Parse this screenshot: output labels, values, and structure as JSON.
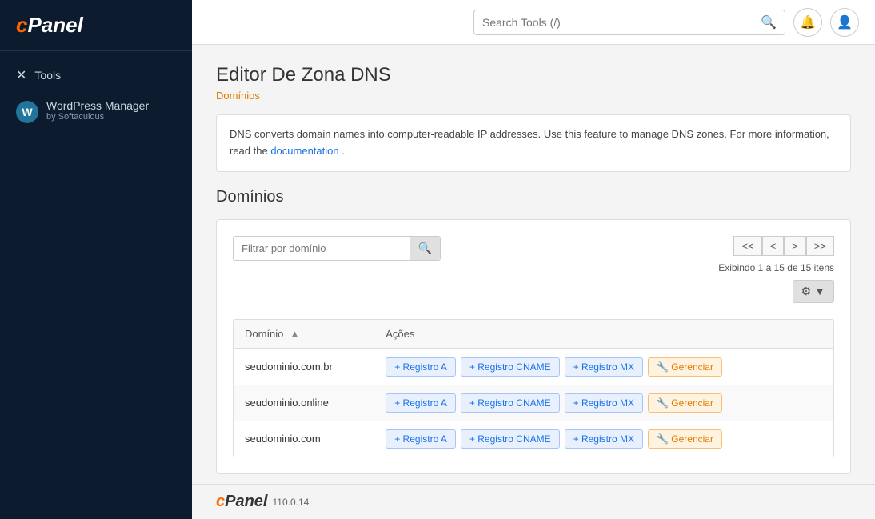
{
  "sidebar": {
    "logo": "cPanel",
    "items": [
      {
        "id": "tools",
        "label": "Tools",
        "icon": "✕"
      }
    ],
    "wordpress": {
      "title": "WordPress Manager",
      "subtitle": "by Softaculous"
    }
  },
  "header": {
    "search_placeholder": "Search Tools (/)",
    "search_value": ""
  },
  "page": {
    "title": "Editor De Zona DNS",
    "breadcrumb": "Domínios",
    "description_plain": "DNS converts domain names into computer-readable IP addresses.",
    "description_link_text": "Use this feature to manage DNS zones. For more information, read the",
    "doc_link": "documentation",
    "description_end": ".",
    "domains_section_title": "Domínios",
    "filter_placeholder": "Filtrar por domínio",
    "pagination": {
      "first": "<<",
      "prev": "<",
      "next": ">",
      "last": ">>",
      "info": "Exibindo 1 a 15 de 15 itens"
    },
    "table": {
      "col_domain": "Domínio",
      "col_actions": "Ações",
      "rows": [
        {
          "domain": "seudominio.com.br",
          "actions": [
            "+ Registro A",
            "+ Registro CNAME",
            "+ Registro MX",
            "🔧 Gerenciar"
          ]
        },
        {
          "domain": "seudominio.online",
          "actions": [
            "+ Registro A",
            "+ Registro CNAME",
            "+ Registro MX",
            "🔧 Gerenciar"
          ]
        },
        {
          "domain": "seudominio.com",
          "actions": [
            "+ Registro A",
            "+ Registro CNAME",
            "+ Registro MX",
            "🔧 Gerenciar"
          ]
        }
      ]
    }
  },
  "footer": {
    "logo_c": "c",
    "logo_panel": "Panel",
    "version": "110.0.14"
  }
}
